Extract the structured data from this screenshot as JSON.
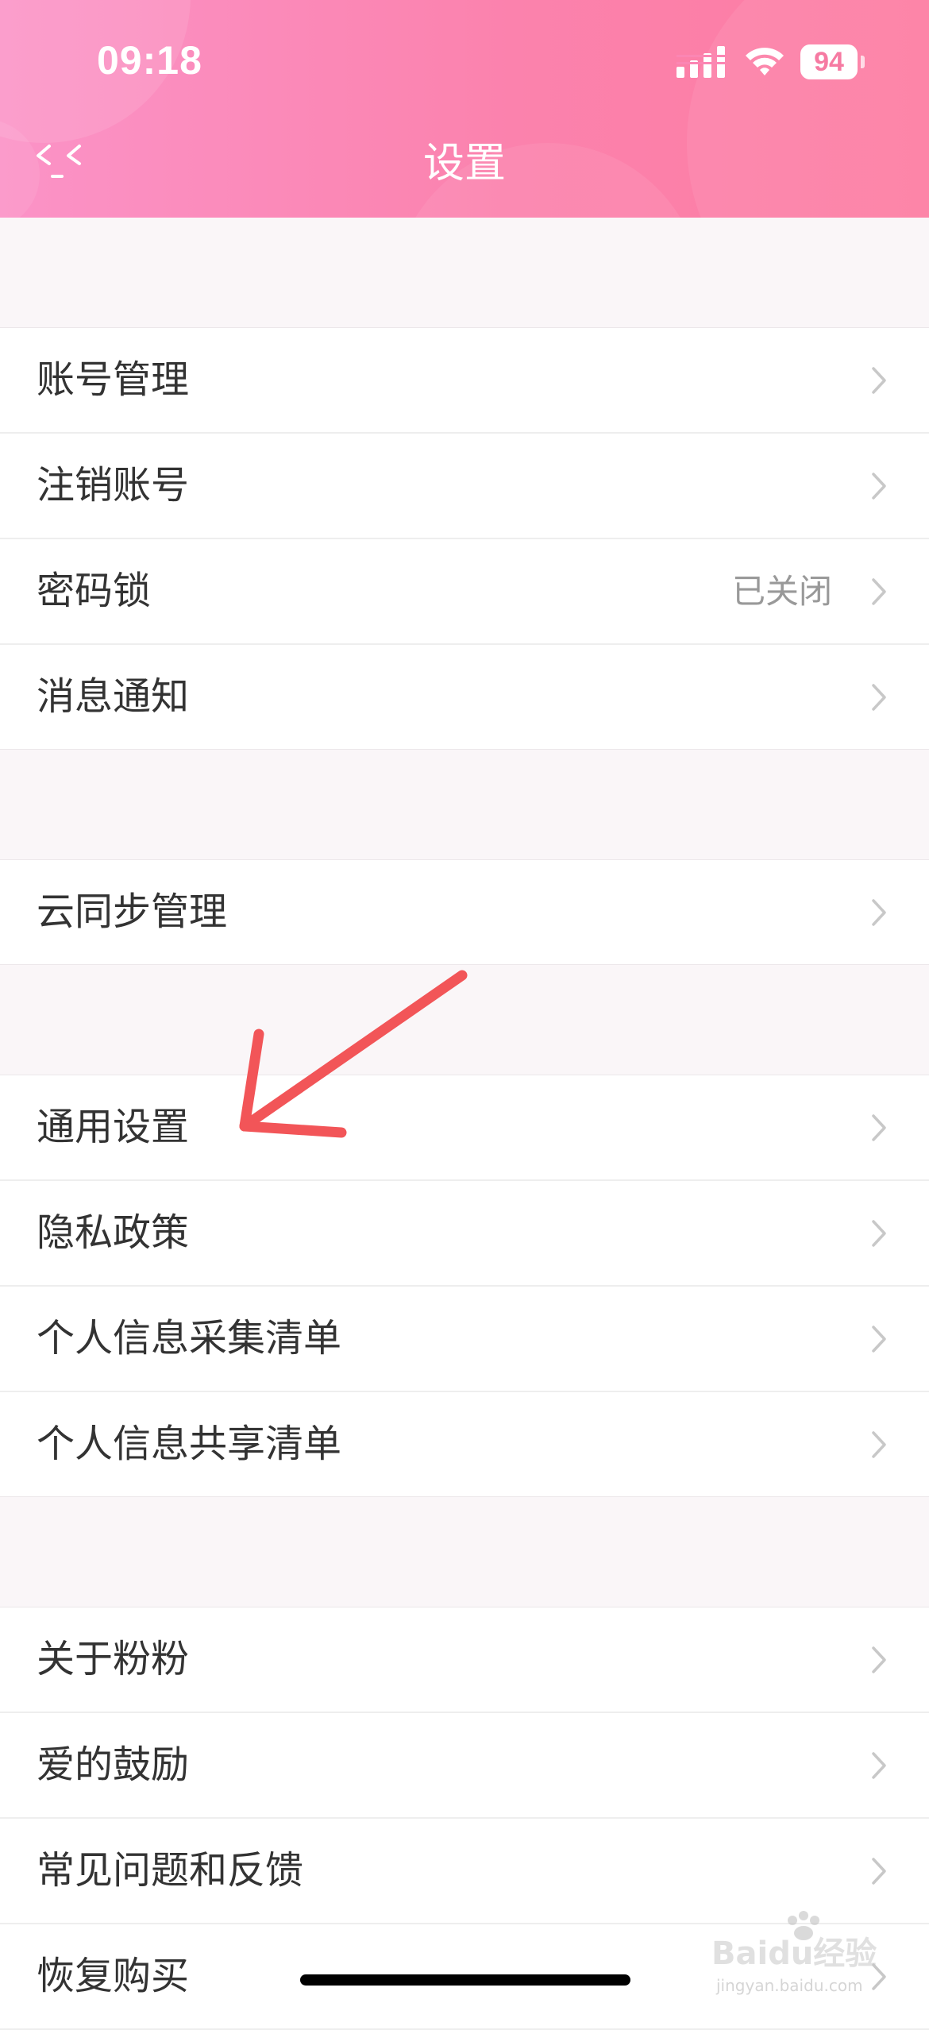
{
  "status_bar": {
    "time": "09:18",
    "battery_level": "94",
    "icons": [
      "signal-icon",
      "wifi-icon",
      "battery-icon"
    ]
  },
  "header": {
    "title": "设置",
    "back_icon": "back-icon"
  },
  "groups": [
    {
      "items": [
        {
          "label": "账号管理"
        },
        {
          "label": "注销账号"
        },
        {
          "label": "密码锁",
          "value": "已关闭"
        },
        {
          "label": "消息通知"
        }
      ]
    },
    {
      "items": [
        {
          "label": "云同步管理"
        }
      ]
    },
    {
      "items": [
        {
          "label": "通用设置"
        },
        {
          "label": "隐私政策"
        },
        {
          "label": "个人信息采集清单"
        },
        {
          "label": "个人信息共享清单"
        }
      ]
    },
    {
      "items": [
        {
          "label": "关于粉粉"
        },
        {
          "label": "爱的鼓励"
        },
        {
          "label": "常见问题和反馈"
        },
        {
          "label": "恢复购买"
        }
      ]
    }
  ],
  "annotation": {
    "type": "red-arrow",
    "points_to": "通用设置",
    "color": "#f25558"
  },
  "watermark": {
    "text": "Baidu经验",
    "sub": "jingyan.baidu.com"
  },
  "colors": {
    "header_start": "#fb93c7",
    "header_end": "#fd7ca2",
    "background": "#faf6f8",
    "row_text": "#333333",
    "secondary_text": "#999999",
    "chevron": "#c8c8c8"
  }
}
